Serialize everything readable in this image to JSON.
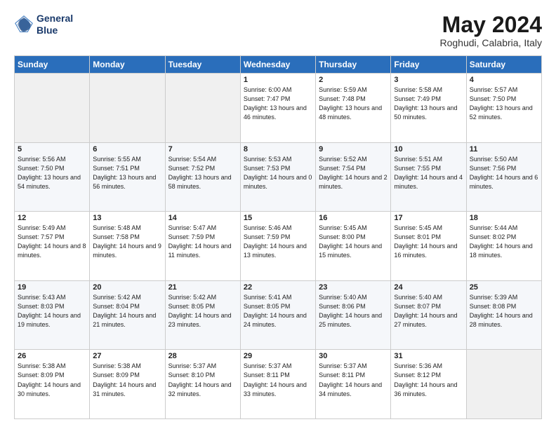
{
  "header": {
    "logo_line1": "General",
    "logo_line2": "Blue",
    "month": "May 2024",
    "location": "Roghudi, Calabria, Italy"
  },
  "weekdays": [
    "Sunday",
    "Monday",
    "Tuesday",
    "Wednesday",
    "Thursday",
    "Friday",
    "Saturday"
  ],
  "weeks": [
    [
      {
        "day": "",
        "empty": true
      },
      {
        "day": "",
        "empty": true
      },
      {
        "day": "",
        "empty": true
      },
      {
        "day": "1",
        "sunrise": "6:00 AM",
        "sunset": "7:47 PM",
        "daylight": "13 hours and 46 minutes."
      },
      {
        "day": "2",
        "sunrise": "5:59 AM",
        "sunset": "7:48 PM",
        "daylight": "13 hours and 48 minutes."
      },
      {
        "day": "3",
        "sunrise": "5:58 AM",
        "sunset": "7:49 PM",
        "daylight": "13 hours and 50 minutes."
      },
      {
        "day": "4",
        "sunrise": "5:57 AM",
        "sunset": "7:50 PM",
        "daylight": "13 hours and 52 minutes."
      }
    ],
    [
      {
        "day": "5",
        "sunrise": "5:56 AM",
        "sunset": "7:50 PM",
        "daylight": "13 hours and 54 minutes."
      },
      {
        "day": "6",
        "sunrise": "5:55 AM",
        "sunset": "7:51 PM",
        "daylight": "13 hours and 56 minutes."
      },
      {
        "day": "7",
        "sunrise": "5:54 AM",
        "sunset": "7:52 PM",
        "daylight": "13 hours and 58 minutes."
      },
      {
        "day": "8",
        "sunrise": "5:53 AM",
        "sunset": "7:53 PM",
        "daylight": "14 hours and 0 minutes."
      },
      {
        "day": "9",
        "sunrise": "5:52 AM",
        "sunset": "7:54 PM",
        "daylight": "14 hours and 2 minutes."
      },
      {
        "day": "10",
        "sunrise": "5:51 AM",
        "sunset": "7:55 PM",
        "daylight": "14 hours and 4 minutes."
      },
      {
        "day": "11",
        "sunrise": "5:50 AM",
        "sunset": "7:56 PM",
        "daylight": "14 hours and 6 minutes."
      }
    ],
    [
      {
        "day": "12",
        "sunrise": "5:49 AM",
        "sunset": "7:57 PM",
        "daylight": "14 hours and 8 minutes."
      },
      {
        "day": "13",
        "sunrise": "5:48 AM",
        "sunset": "7:58 PM",
        "daylight": "14 hours and 9 minutes."
      },
      {
        "day": "14",
        "sunrise": "5:47 AM",
        "sunset": "7:59 PM",
        "daylight": "14 hours and 11 minutes."
      },
      {
        "day": "15",
        "sunrise": "5:46 AM",
        "sunset": "7:59 PM",
        "daylight": "14 hours and 13 minutes."
      },
      {
        "day": "16",
        "sunrise": "5:45 AM",
        "sunset": "8:00 PM",
        "daylight": "14 hours and 15 minutes."
      },
      {
        "day": "17",
        "sunrise": "5:45 AM",
        "sunset": "8:01 PM",
        "daylight": "14 hours and 16 minutes."
      },
      {
        "day": "18",
        "sunrise": "5:44 AM",
        "sunset": "8:02 PM",
        "daylight": "14 hours and 18 minutes."
      }
    ],
    [
      {
        "day": "19",
        "sunrise": "5:43 AM",
        "sunset": "8:03 PM",
        "daylight": "14 hours and 19 minutes."
      },
      {
        "day": "20",
        "sunrise": "5:42 AM",
        "sunset": "8:04 PM",
        "daylight": "14 hours and 21 minutes."
      },
      {
        "day": "21",
        "sunrise": "5:42 AM",
        "sunset": "8:05 PM",
        "daylight": "14 hours and 23 minutes."
      },
      {
        "day": "22",
        "sunrise": "5:41 AM",
        "sunset": "8:05 PM",
        "daylight": "14 hours and 24 minutes."
      },
      {
        "day": "23",
        "sunrise": "5:40 AM",
        "sunset": "8:06 PM",
        "daylight": "14 hours and 25 minutes."
      },
      {
        "day": "24",
        "sunrise": "5:40 AM",
        "sunset": "8:07 PM",
        "daylight": "14 hours and 27 minutes."
      },
      {
        "day": "25",
        "sunrise": "5:39 AM",
        "sunset": "8:08 PM",
        "daylight": "14 hours and 28 minutes."
      }
    ],
    [
      {
        "day": "26",
        "sunrise": "5:38 AM",
        "sunset": "8:09 PM",
        "daylight": "14 hours and 30 minutes."
      },
      {
        "day": "27",
        "sunrise": "5:38 AM",
        "sunset": "8:09 PM",
        "daylight": "14 hours and 31 minutes."
      },
      {
        "day": "28",
        "sunrise": "5:37 AM",
        "sunset": "8:10 PM",
        "daylight": "14 hours and 32 minutes."
      },
      {
        "day": "29",
        "sunrise": "5:37 AM",
        "sunset": "8:11 PM",
        "daylight": "14 hours and 33 minutes."
      },
      {
        "day": "30",
        "sunrise": "5:37 AM",
        "sunset": "8:11 PM",
        "daylight": "14 hours and 34 minutes."
      },
      {
        "day": "31",
        "sunrise": "5:36 AM",
        "sunset": "8:12 PM",
        "daylight": "14 hours and 36 minutes."
      },
      {
        "day": "",
        "empty": true
      }
    ]
  ]
}
